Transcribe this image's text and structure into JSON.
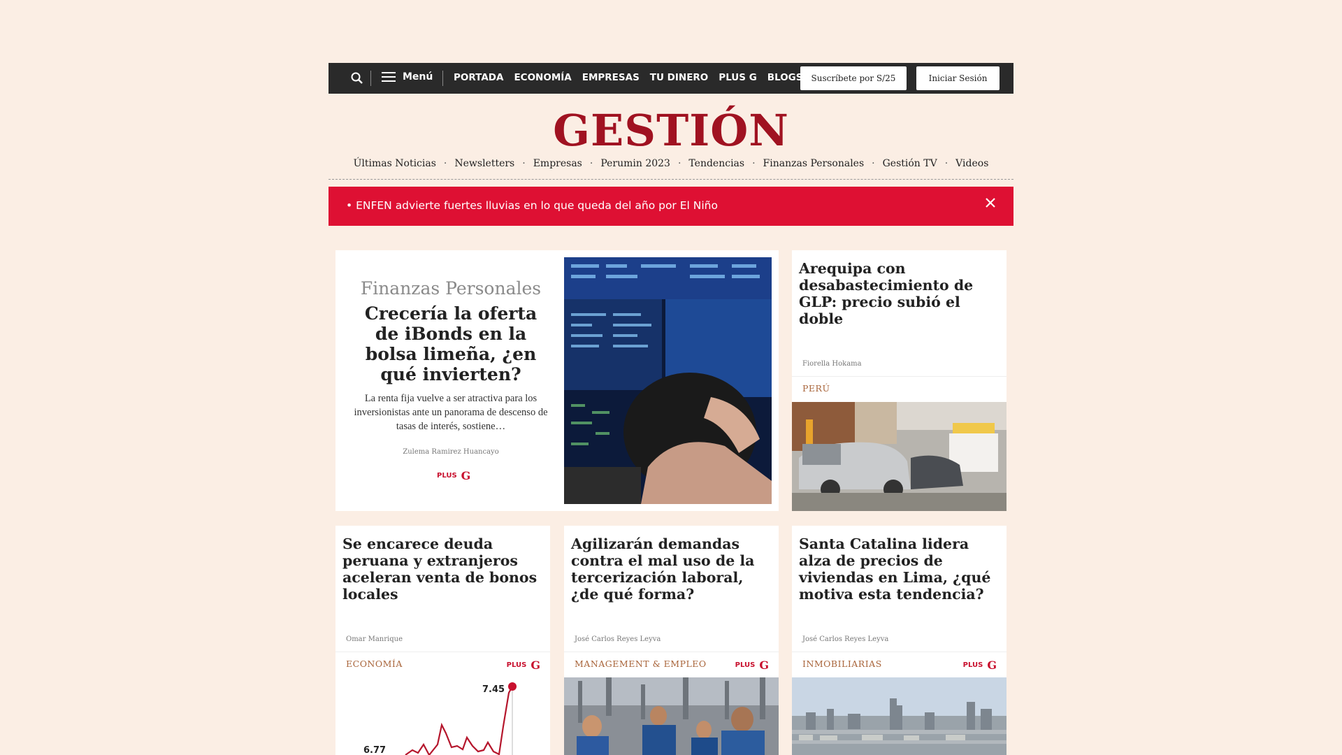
{
  "topnav": {
    "menu_label": "Menú",
    "links": [
      "PORTADA",
      "ECONOMÍA",
      "EMPRESAS",
      "TU DINERO",
      "PLUS G",
      "BLOGS"
    ],
    "subscribe_label": "Suscríbete por S/25",
    "login_label": "Iniciar Sesión",
    "bg_color": "#2a2a2a"
  },
  "logo": {
    "text": "GESTIÓN",
    "color": "#a01221"
  },
  "subnav": {
    "items": [
      "Últimas Noticias",
      "Newsletters",
      "Empresas",
      "Perumin 2023",
      "Tendencias",
      "Finanzas Personales",
      "Gestión TV",
      "Videos"
    ],
    "separator": "·"
  },
  "alert": {
    "text": "• ENFEN advierte fuertes lluvias en lo que queda del año por El Niño",
    "color": "#de1033"
  },
  "plus_badge": {
    "label": "PLUS",
    "mark": "G"
  },
  "featured": {
    "kicker": "Finanzas Personales",
    "title": "Crecería la oferta de iBonds en la bolsa limeña, ¿en qué invierten?",
    "summary": "La renta fija vuelve a ser atractiva para los inversionistas ante un panorama de descenso de tasas de interés, sostiene…",
    "author": "Zulema Ramirez Huancayo",
    "image": "stock-exchange-trader-photo"
  },
  "cards": [
    {
      "title": "Arequipa con desabastecimiento de GLP: precio subió el doble",
      "author": "Fiorella Hokama",
      "section": "PERÚ",
      "plus": false,
      "image": "gas-station-queue-photo"
    },
    {
      "title": "Se encarece deuda peruana y extranjeros aceleran venta de bonos locales",
      "author": "Omar Manrique",
      "section": "ECONOMÍA",
      "plus": true,
      "image": "bond-yield-chart",
      "chart_labels": [
        "7.45",
        "6.77"
      ]
    },
    {
      "title": "Agilizarán demandas contra el mal uso de la tercerización laboral, ¿de qué forma?",
      "author": "José Carlos Reyes Leyva",
      "section": "MANAGEMENT & EMPLEO",
      "plus": true,
      "image": "factory-workers-photo"
    },
    {
      "title": "Santa Catalina lidera alza de precios de viviendas en Lima, ¿qué motiva esta tendencia?",
      "author": "José Carlos Reyes Leyva",
      "section": "INMOBILIARIAS",
      "plus": true,
      "image": "lima-skyline-photo"
    }
  ]
}
